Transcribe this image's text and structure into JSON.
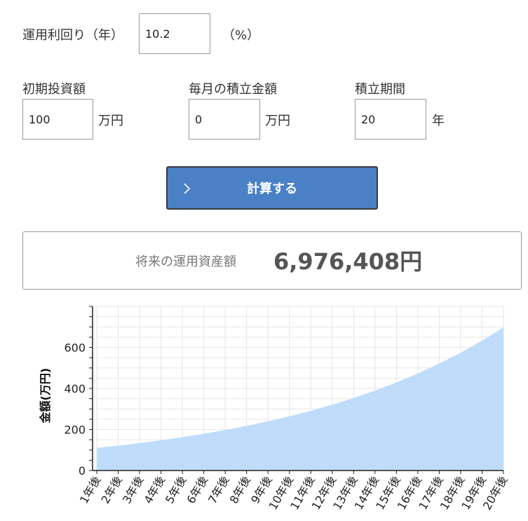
{
  "form": {
    "rate_label": "運用利回り（年）",
    "rate_value": "10.2",
    "rate_unit": "（%）",
    "initial_label": "初期投資額",
    "initial_value": "100",
    "initial_unit": "万円",
    "monthly_label": "毎月の積立金額",
    "monthly_value": "0",
    "monthly_unit": "万円",
    "period_label": "積立期間",
    "period_value": "20",
    "period_unit": "年"
  },
  "calculate_button": {
    "label": "計算する",
    "icon": "chevron-right-icon"
  },
  "result": {
    "label": "将来の運用資産額",
    "value": "6,976,408円"
  },
  "colors": {
    "button": "#4a80c5",
    "area_fill": "#bfdcfb",
    "grid": "#e6e6e6"
  },
  "chart_data": {
    "type": "area",
    "ylabel": "金額(万円)",
    "xlabel": "",
    "ylim": [
      0,
      800
    ],
    "yticks": [
      0,
      200,
      400,
      600
    ],
    "grid": true,
    "categories": [
      "1年後",
      "2年後",
      "3年後",
      "4年後",
      "5年後",
      "6年後",
      "7年後",
      "8年後",
      "9年後",
      "10年後",
      "11年後",
      "12年後",
      "13年後",
      "14年後",
      "15年後",
      "16年後",
      "17年後",
      "18年後",
      "19年後",
      "20年後"
    ],
    "series": [
      {
        "values": [
          110.2,
          121.4,
          133.8,
          147.5,
          162.5,
          179.1,
          197.4,
          217.5,
          239.7,
          264.1,
          291.1,
          320.8,
          353.5,
          389.5,
          429.3,
          473.1,
          521.3,
          574.5,
          633.1,
          697.6
        ]
      }
    ]
  }
}
